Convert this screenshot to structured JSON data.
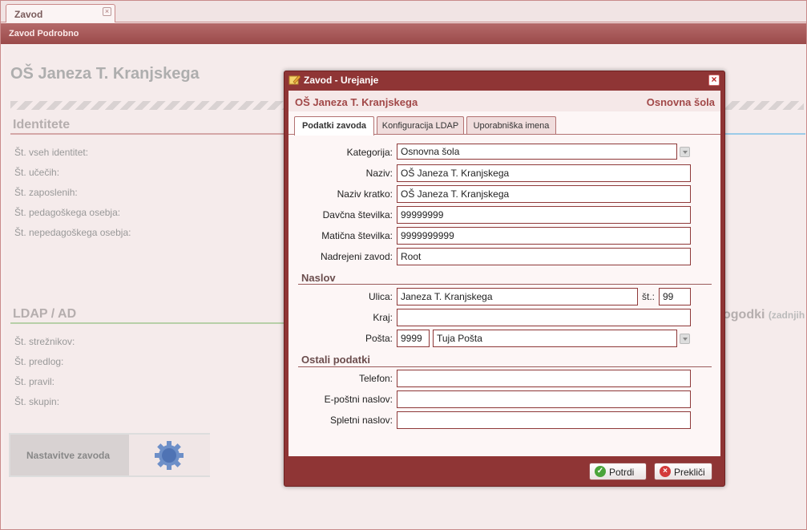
{
  "app": {
    "tab_label": "Zavod",
    "titlebar": "Zavod Podrobno",
    "school_name": "OŠ Janeza T. Kranjskega",
    "identities": {
      "heading": "Identitete",
      "stats": [
        "Št. vseh identitet:",
        "Št. učečih:",
        "Št. zaposlenih:",
        "Št. pedagoškega osebja:",
        "Št. nepedagoškega osebja:"
      ]
    },
    "ldap": {
      "heading": "LDAP / AD",
      "stats": [
        "Št. strežnikov:",
        "Št. predlog:",
        "Št. pravil:",
        "Št. skupin:"
      ]
    },
    "events": {
      "heading": "ogodki",
      "subtitle": "(zadnjih"
    },
    "settings_label": "Nastavitve zavoda"
  },
  "colors": {
    "accent": "#8f3535",
    "header": "#a14848",
    "line_identity": "#d4a7a7",
    "line_ldap": "#b7cfa8",
    "line_events": "#9ccbe8"
  },
  "dialog": {
    "title": "Zavod - Urejanje",
    "school": "OŠ Janeza T. Kranjskega",
    "kind": "Osnovna šola",
    "tabs": [
      "Podatki zavoda",
      "Konfiguracija LDAP",
      "Uporabniška imena"
    ],
    "active_tab": "Podatki zavoda",
    "fields": {
      "kategorija": {
        "label": "Kategorija:",
        "value": "Osnovna šola"
      },
      "naziv": {
        "label": "Naziv:",
        "value": "OŠ Janeza T. Kranjskega"
      },
      "naziv_kratko": {
        "label": "Naziv kratko:",
        "value": "OŠ Janeza T. Kranjskega"
      },
      "davcna": {
        "label": "Davčna številka:",
        "value": "99999999"
      },
      "maticna": {
        "label": "Matična številka:",
        "value": "9999999999"
      },
      "nadrejeni": {
        "label": "Nadrejeni zavod:",
        "value": "Root"
      }
    },
    "naslov": {
      "title": "Naslov",
      "ulica": {
        "label": "Ulica:",
        "value": "Janeza T. Kranjskega"
      },
      "st": {
        "label": "št.:",
        "value": "99"
      },
      "kraj": {
        "label": "Kraj:",
        "value": ""
      },
      "posta": {
        "label": "Pošta:",
        "number": "9999",
        "name": "Tuja Pošta"
      }
    },
    "ostali": {
      "title": "Ostali podatki",
      "telefon": {
        "label": "Telefon:",
        "value": ""
      },
      "email": {
        "label": "E-poštni naslov:",
        "value": ""
      },
      "web": {
        "label": "Spletni naslov:",
        "value": ""
      }
    },
    "buttons": {
      "confirm": "Potrdi",
      "cancel": "Prekliči"
    }
  }
}
